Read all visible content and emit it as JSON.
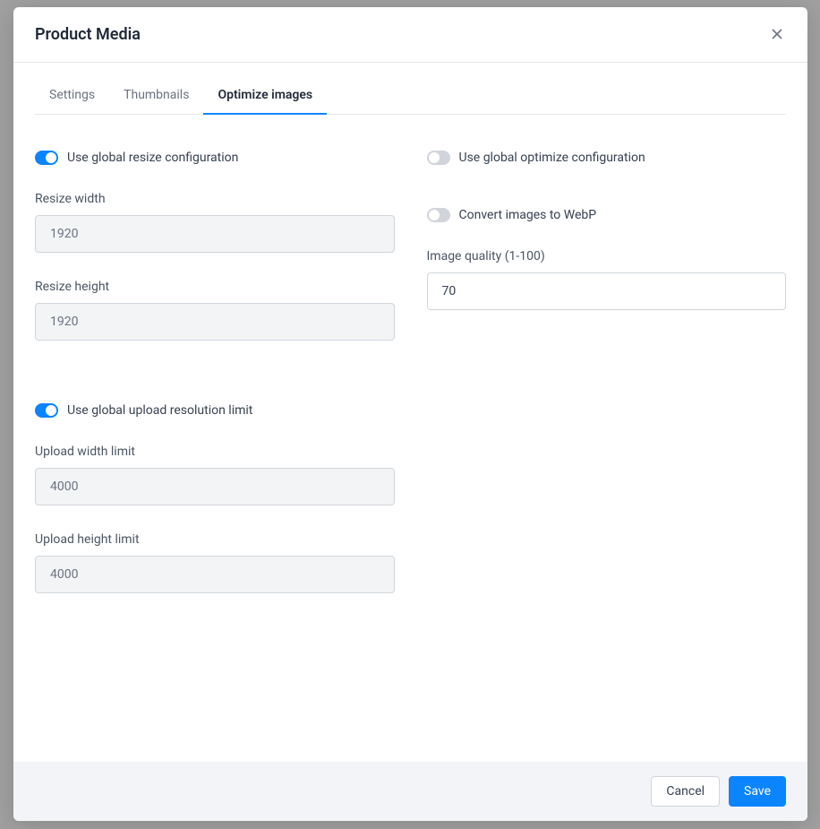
{
  "modal": {
    "title": "Product Media"
  },
  "tabs": [
    {
      "label": "Settings"
    },
    {
      "label": "Thumbnails"
    },
    {
      "label": "Optimize images"
    }
  ],
  "left": {
    "global_resize_label": "Use global resize configuration",
    "resize_width_label": "Resize width",
    "resize_width_value": "1920",
    "resize_height_label": "Resize height",
    "resize_height_value": "1920",
    "global_upload_label": "Use global upload resolution limit",
    "upload_width_label": "Upload width limit",
    "upload_width_value": "4000",
    "upload_height_label": "Upload height limit",
    "upload_height_value": "4000"
  },
  "right": {
    "global_optimize_label": "Use global optimize configuration",
    "convert_webp_label": "Convert images to WebP",
    "image_quality_label": "Image quality (1-100)",
    "image_quality_value": "70"
  },
  "footer": {
    "cancel": "Cancel",
    "save": "Save"
  }
}
